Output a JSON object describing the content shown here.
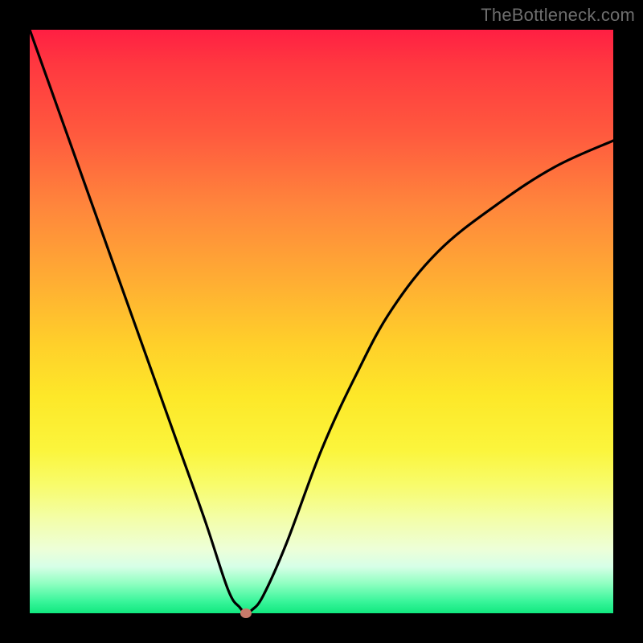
{
  "watermark": "TheBottleneck.com",
  "colors": {
    "frame": "#000000",
    "curve": "#000000",
    "marker": "#c77a6a",
    "gradient_top": "#ff1f43",
    "gradient_bottom": "#11e87f"
  },
  "chart_data": {
    "type": "line",
    "title": "",
    "xlabel": "",
    "ylabel": "",
    "xlim": [
      0,
      100
    ],
    "ylim": [
      0,
      100
    ],
    "axes_visible": false,
    "grid": false,
    "series": [
      {
        "name": "bottleneck-curve",
        "x": [
          0,
          5,
          10,
          15,
          20,
          25,
          30,
          34,
          36,
          37,
          38,
          40,
          44,
          50,
          56,
          62,
          70,
          80,
          90,
          100
        ],
        "y": [
          100,
          86,
          72,
          58,
          44,
          30,
          16,
          4,
          1,
          0,
          0.5,
          3,
          12,
          28,
          41,
          52,
          62,
          70,
          76.5,
          81
        ]
      }
    ],
    "marker": {
      "x": 37,
      "y": 0,
      "label": "optimal-point"
    }
  }
}
